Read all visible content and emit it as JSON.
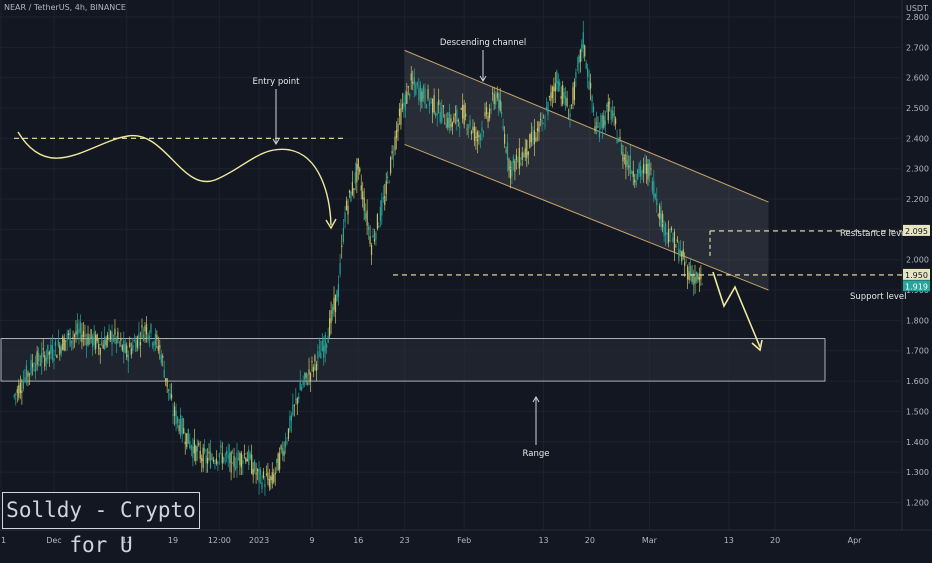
{
  "header": {
    "symbol_line": "NEAR / TetherUS, 4h, BINANCE"
  },
  "brand_box": {
    "text": "Solldy - Crypto for U"
  },
  "colors": {
    "background": "#131722",
    "grid": "#1e222d",
    "candle": "#26a69a",
    "candle_alt": "#c8c46a",
    "annotation": "#f0eaa0",
    "channel_line": "#c8a36b",
    "range_fill": "#2a2e39"
  },
  "chart_data": {
    "type": "line",
    "title": "",
    "xlabel": "",
    "ylabel": "",
    "y_unit": "USDT",
    "ylim": [
      1.16,
      2.91
    ],
    "x_ticks": [
      "1",
      "Dec",
      "12",
      "19",
      "12:00",
      "2023",
      "9",
      "16",
      "23",
      "Feb",
      "13",
      "20",
      "Mar",
      "13",
      "20",
      "Apr"
    ],
    "y_ticks": [
      "2.800",
      "2.700",
      "2.600",
      "2.500",
      "2.400",
      "2.300",
      "2.200",
      "2.100",
      "2.000",
      "1.900",
      "1.800",
      "1.700",
      "1.600",
      "1.500",
      "1.400",
      "1.300",
      "1.200"
    ],
    "price_tags": [
      {
        "label": "2.095",
        "value": 2.095,
        "color": "#e8e6c0"
      },
      {
        "label": "1.950",
        "value": 1.95,
        "color": "#e8e6c0"
      },
      {
        "label": "1.919",
        "value": 1.919,
        "color": "#26a69a"
      }
    ],
    "x_dates": [
      "2022-11-25",
      "2022-11-28",
      "2022-12-01",
      "2022-12-03",
      "2022-12-05",
      "2022-12-08",
      "2022-12-10",
      "2022-12-12",
      "2022-12-15",
      "2022-12-17",
      "2022-12-19",
      "2022-12-22",
      "2022-12-24",
      "2022-12-26",
      "2022-12-28",
      "2022-12-30",
      "2023-01-01",
      "2023-01-03",
      "2023-01-05",
      "2023-01-07",
      "2023-01-09",
      "2023-01-11",
      "2023-01-13",
      "2023-01-14",
      "2023-01-16",
      "2023-01-18",
      "2023-01-20",
      "2023-01-22",
      "2023-01-24",
      "2023-01-27",
      "2023-01-30",
      "2023-02-01",
      "2023-02-03",
      "2023-02-06",
      "2023-02-08",
      "2023-02-10",
      "2023-02-13",
      "2023-02-15",
      "2023-02-17",
      "2023-02-19",
      "2023-02-21",
      "2023-02-23",
      "2023-02-25",
      "2023-02-27",
      "2023-03-01",
      "2023-03-03",
      "2023-03-05",
      "2023-03-07",
      "2023-03-09"
    ],
    "series": [
      {
        "values": [
          1.55,
          1.66,
          1.7,
          1.74,
          1.76,
          1.72,
          1.75,
          1.69,
          1.78,
          1.71,
          1.5,
          1.38,
          1.34,
          1.36,
          1.33,
          1.36,
          1.28,
          1.27,
          1.4,
          1.56,
          1.64,
          1.72,
          1.9,
          2.15,
          2.3,
          2.05,
          2.2,
          2.45,
          2.58,
          2.52,
          2.45,
          2.48,
          2.4,
          2.55,
          2.3,
          2.35,
          2.45,
          2.6,
          2.48,
          2.72,
          2.42,
          2.5,
          2.35,
          2.28,
          2.3,
          2.12,
          2.05,
          1.96,
          1.92
        ]
      }
    ],
    "annotations": [
      {
        "text": "Entry point"
      },
      {
        "text": "Descending channel"
      },
      {
        "text": "Resistance level",
        "value": 2.095
      },
      {
        "text": "Support level",
        "value": 1.95
      },
      {
        "text": "Range",
        "range": [
          1.6,
          1.74
        ]
      }
    ],
    "dashed_levels": [
      2.4,
      2.095,
      1.95
    ],
    "channel": {
      "upper_start": 2.69,
      "upper_end": 2.19,
      "lower_start": 2.38,
      "lower_end": 1.9
    },
    "grid": true
  }
}
